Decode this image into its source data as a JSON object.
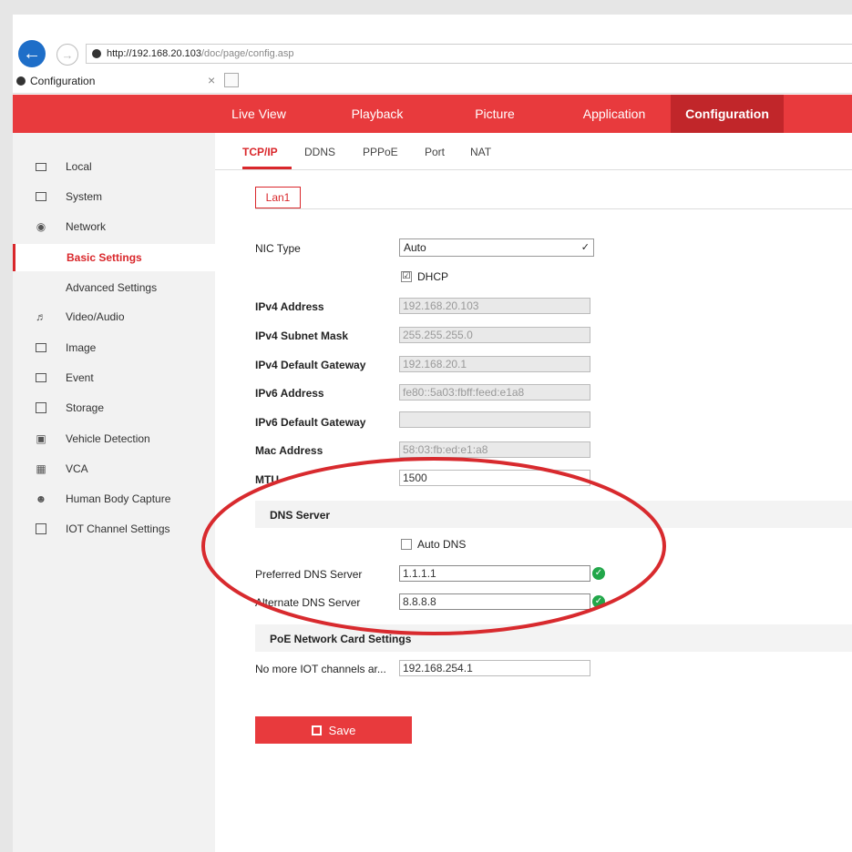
{
  "browser": {
    "url_host": "http://192.168.20.103",
    "url_path": "/doc/page/config.asp",
    "tab_title": "Configuration",
    "tab_close": "×"
  },
  "nav": {
    "items": [
      "Live View",
      "Playback",
      "Picture",
      "Application",
      "Configuration"
    ],
    "active": "Configuration",
    "accent": "#e83a3d"
  },
  "sidebar": {
    "items": [
      {
        "label": "Local",
        "icon": "monitor-icon"
      },
      {
        "label": "System",
        "icon": "window-icon"
      },
      {
        "label": "Network",
        "icon": "globe-icon"
      },
      {
        "label": "Basic Settings",
        "sub": true,
        "active": true
      },
      {
        "label": "Advanced Settings",
        "sub": true
      },
      {
        "label": "Video/Audio",
        "icon": "video-audio-icon"
      },
      {
        "label": "Image",
        "icon": "image-icon"
      },
      {
        "label": "Event",
        "icon": "event-icon"
      },
      {
        "label": "Storage",
        "icon": "storage-icon"
      },
      {
        "label": "Vehicle Detection",
        "icon": "vehicle-detection-icon"
      },
      {
        "label": "VCA",
        "icon": "vca-icon"
      },
      {
        "label": "Human Body Capture",
        "icon": "human-body-icon"
      },
      {
        "label": "IOT Channel Settings",
        "icon": "iot-icon"
      }
    ]
  },
  "subtabs": [
    "TCP/IP",
    "DDNS",
    "PPPoE",
    "Port",
    "NAT"
  ],
  "lan_tab": "Lan1",
  "form": {
    "nic_type_label": "NIC Type",
    "nic_type_value": "Auto",
    "dhcp_label": "DHCP",
    "dhcp_checked": "☑",
    "ipv4_address_label": "IPv4 Address",
    "ipv4_address": "192.168.20.103",
    "ipv4_mask_label": "IPv4 Subnet Mask",
    "ipv4_mask": "255.255.255.0",
    "ipv4_gateway_label": "IPv4 Default Gateway",
    "ipv4_gateway": "192.168.20.1",
    "ipv6_address_label": "IPv6 Address",
    "ipv6_address": "fe80::5a03:fbff:feed:e1a8",
    "ipv6_gateway_label": "IPv6 Default Gateway",
    "ipv6_gateway": "",
    "mac_label": "Mac Address",
    "mac": "58:03:fb:ed:e1:a8",
    "mtu_label": "MTU",
    "mtu": "1500"
  },
  "dns": {
    "section_title": "DNS Server",
    "auto_dns_label": "Auto DNS",
    "preferred_label": "Preferred DNS Server",
    "preferred": "1.1.1.1",
    "alternate_label": "Alternate DNS Server",
    "alternate": "8.8.8.8"
  },
  "poe": {
    "section_title": "PoE Network Card Settings",
    "iot_label": "No more IOT channels ar...",
    "iot_value": "192.168.254.1"
  },
  "save_label": "Save"
}
